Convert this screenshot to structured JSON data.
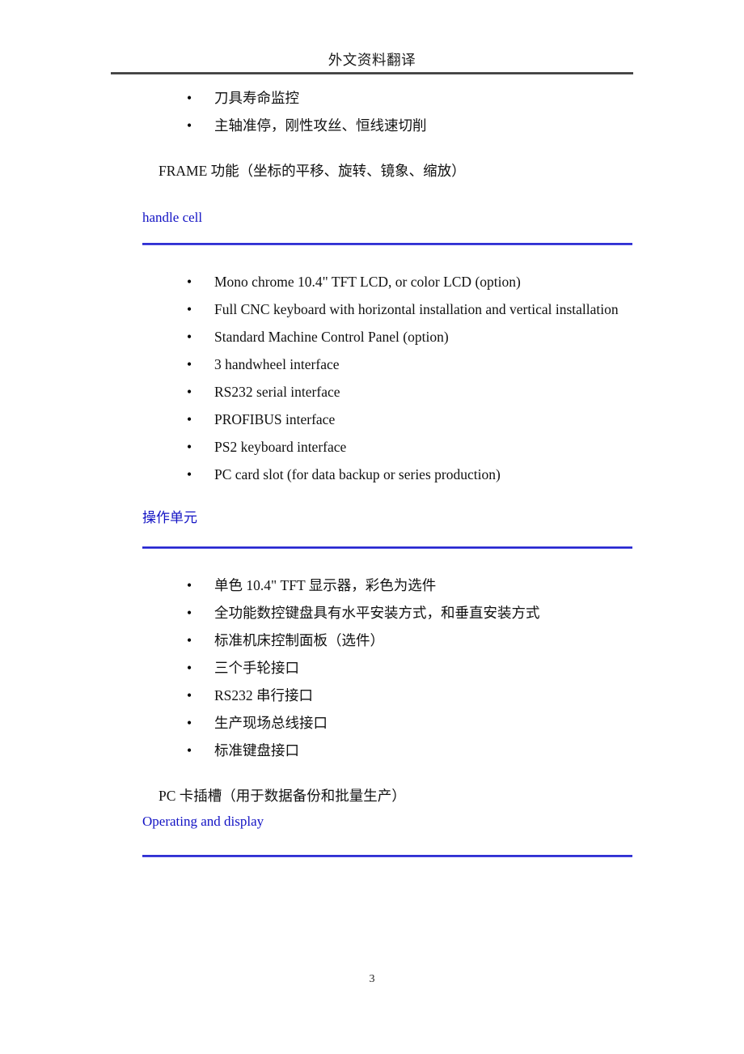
{
  "header": {
    "title": "外文资料翻译"
  },
  "footer": {
    "page_number": "3"
  },
  "colors": {
    "heading_blue": "#1313c4",
    "rule_blue": "#2222cc",
    "header_rule": "#3b3b3b",
    "body_text": "#111111"
  },
  "bullet_glyph": "•",
  "top_list": {
    "items": [
      {
        "text": "刀具寿命监控"
      },
      {
        "text": "主轴准停，刚性攻丝、恒线速切削"
      }
    ]
  },
  "frame_paragraph": {
    "text": "FRAME 功能（坐标的平移、旋转、镜象、缩放）"
  },
  "section_handle_cell": {
    "heading": "handle cell",
    "items": [
      {
        "text": "Mono chrome 10.4\" TFT LCD, or color LCD (option)"
      },
      {
        "text": "Full CNC keyboard with horizontal installation and vertical installation"
      },
      {
        "text": "Standard Machine Control Panel (option)"
      },
      {
        "text": "3 handwheel interface"
      },
      {
        "text": "RS232 serial interface"
      },
      {
        "text": "PROFIBUS interface"
      },
      {
        "text": "PS2 keyboard interface"
      },
      {
        "text": "PC card slot (for data backup or series production)"
      }
    ]
  },
  "section_operating_unit": {
    "heading": "操作单元",
    "items": [
      {
        "text": "单色 10.4\" TFT 显示器，彩色为选件"
      },
      {
        "text": "全功能数控键盘具有水平安装方式，和垂直安装方式"
      },
      {
        "text": "标准机床控制面板（选件）"
      },
      {
        "text": "三个手轮接口"
      },
      {
        "text": "RS232 串行接口"
      },
      {
        "text": "生产现场总线接口"
      },
      {
        "text": "标准键盘接口"
      }
    ],
    "trailing_paragraph": "PC 卡插槽（用于数据备份和批量生产）"
  },
  "section_operating_display": {
    "heading": "Operating and display"
  }
}
